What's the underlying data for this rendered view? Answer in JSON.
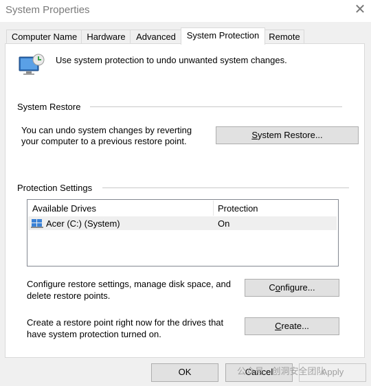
{
  "window": {
    "title": "System Properties"
  },
  "tabs": [
    {
      "label": "Computer Name"
    },
    {
      "label": "Hardware"
    },
    {
      "label": "Advanced"
    },
    {
      "label": "System Protection"
    },
    {
      "label": "Remote"
    }
  ],
  "header": {
    "text": "Use system protection to undo unwanted system changes."
  },
  "restore": {
    "group_label": "System Restore",
    "description_line1": "You can undo system changes by reverting",
    "description_line2": "your computer to a previous restore point.",
    "button_prefix": "",
    "button_accel": "S",
    "button_rest": "ystem Restore..."
  },
  "protection": {
    "group_label": "Protection Settings",
    "columns": [
      "Available Drives",
      "Protection"
    ],
    "rows": [
      {
        "drive": "Acer (C:) (System)",
        "status": "On"
      }
    ],
    "configure_text_line1": "Configure restore settings, manage disk space, and",
    "configure_text_line2": "delete restore points.",
    "configure_prefix": "C",
    "configure_accel": "o",
    "configure_rest": "nfigure...",
    "create_text_line1": "Create a restore point right now for the drives that",
    "create_text_line2": "have system protection turned on.",
    "create_accel": "C",
    "create_rest": "reate..."
  },
  "footer": {
    "ok": "OK",
    "cancel": "Cancel",
    "apply": "Apply"
  },
  "watermark": "公众号 · 创洞安全团队",
  "icons": {
    "shield": "monitor-shield-icon",
    "drive": "drive-icon",
    "close": "close-icon"
  }
}
